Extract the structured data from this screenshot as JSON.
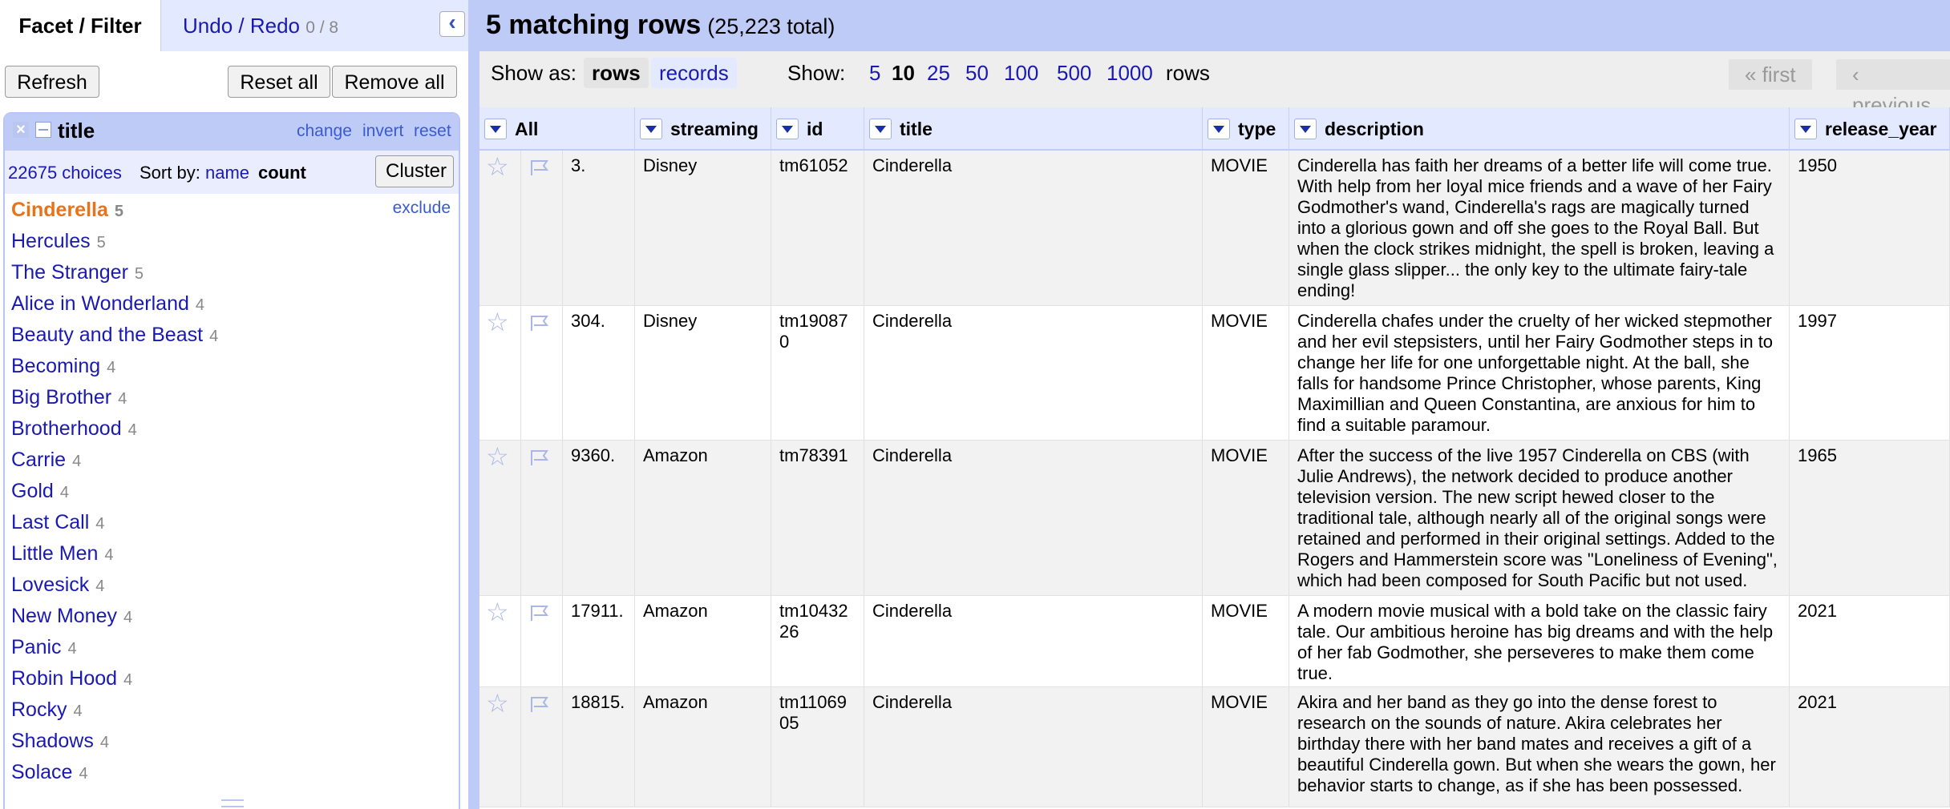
{
  "left_panel": {
    "tabs": {
      "facet_filter": "Facet / Filter",
      "undo_redo": "Undo / Redo",
      "undo_count": "0 / 8"
    },
    "buttons": {
      "refresh": "Refresh",
      "reset_all": "Reset all",
      "remove_all": "Remove all"
    },
    "facet": {
      "title": "title",
      "links": {
        "change": "change",
        "invert": "invert",
        "reset": "reset"
      },
      "choices_text": "22675 choices",
      "sort_by": "Sort by:",
      "sort_name": "name",
      "sort_count": "count",
      "cluster": "Cluster",
      "exclude": "exclude",
      "items": [
        {
          "name": "Cinderella",
          "count": "5"
        },
        {
          "name": "Hercules",
          "count": "5"
        },
        {
          "name": "The Stranger",
          "count": "5"
        },
        {
          "name": "Alice in Wonderland",
          "count": "4"
        },
        {
          "name": "Beauty and the Beast",
          "count": "4"
        },
        {
          "name": "Becoming",
          "count": "4"
        },
        {
          "name": "Big Brother",
          "count": "4"
        },
        {
          "name": "Brotherhood",
          "count": "4"
        },
        {
          "name": "Carrie",
          "count": "4"
        },
        {
          "name": "Gold",
          "count": "4"
        },
        {
          "name": "Last Call",
          "count": "4"
        },
        {
          "name": "Little Men",
          "count": "4"
        },
        {
          "name": "Lovesick",
          "count": "4"
        },
        {
          "name": "New Money",
          "count": "4"
        },
        {
          "name": "Panic",
          "count": "4"
        },
        {
          "name": "Robin Hood",
          "count": "4"
        },
        {
          "name": "Rocky",
          "count": "4"
        },
        {
          "name": "Shadows",
          "count": "4"
        },
        {
          "name": "Solace",
          "count": "4"
        }
      ]
    }
  },
  "right_panel": {
    "summary": {
      "matching": "5 matching rows",
      "total": "(25,223 total)"
    },
    "view": {
      "show_as": "Show as:",
      "mode_rows": "rows",
      "mode_records": "records",
      "show": "Show:",
      "page_sizes": [
        "5",
        "10",
        "25",
        "50",
        "100",
        "500",
        "1000"
      ],
      "rows_label": "rows",
      "first": "« first",
      "previous": "‹ previous"
    },
    "columns": [
      "All",
      "streaming",
      "id",
      "title",
      "type",
      "description",
      "release_year"
    ],
    "rows": [
      {
        "index": "3.",
        "streaming": "Disney",
        "id": "tm61052",
        "title": "Cinderella",
        "type": "MOVIE",
        "description": "Cinderella has faith her dreams of a better life will come true. With help from her loyal mice friends and a wave of her Fairy Godmother's wand, Cinderella's rags are magically turned into a glorious gown and off she goes to the Royal Ball. But when the clock strikes midnight, the spell is broken, leaving a single glass slipper... the only key to the ultimate fairy-tale ending!",
        "release_year": "1950"
      },
      {
        "index": "304.",
        "streaming": "Disney",
        "id": "tm190870",
        "title": "Cinderella",
        "type": "MOVIE",
        "description": "Cinderella chafes under the cruelty of her wicked stepmother and her evil stepsisters, until her Fairy Godmother steps in to change her life for one unforgettable night. At the ball, she falls for handsome Prince Christopher, whose parents, King Maximillian and Queen Constantina, are anxious for him to find a suitable paramour.",
        "release_year": "1997"
      },
      {
        "index": "9360.",
        "streaming": "Amazon",
        "id": "tm78391",
        "title": "Cinderella",
        "type": "MOVIE",
        "description": "After the success of the  live 1957 Cinderella on CBS (with Julie Andrews), the network decided to produce another television version. The new script hewed closer to the traditional tale, although nearly all of the original songs were retained and performed in their original settings. Added to the Rogers and Hammerstein score was \"Loneliness of Evening\", which had been composed for South Pacific but not used.",
        "release_year": "1965"
      },
      {
        "index": "17911.",
        "streaming": "Amazon",
        "id": "tm1043226",
        "title": "Cinderella",
        "type": "MOVIE",
        "description": "A modern movie musical with a bold take on the classic fairy tale. Our ambitious heroine has big dreams and with the help of her fab Godmother, she perseveres to make them come true.",
        "release_year": "2021"
      },
      {
        "index": "18815.",
        "streaming": "Amazon",
        "id": "tm1106905",
        "title": "Cinderella",
        "type": "MOVIE",
        "description": "Akira and her band as they go into the dense forest to research on the sounds of nature. Akira celebrates her birthday there with her band mates and receives a gift of a beautiful Cinderella gown. But when she wears the gown, her behavior starts to change, as if she has been possessed.",
        "release_year": "2021"
      }
    ]
  }
}
